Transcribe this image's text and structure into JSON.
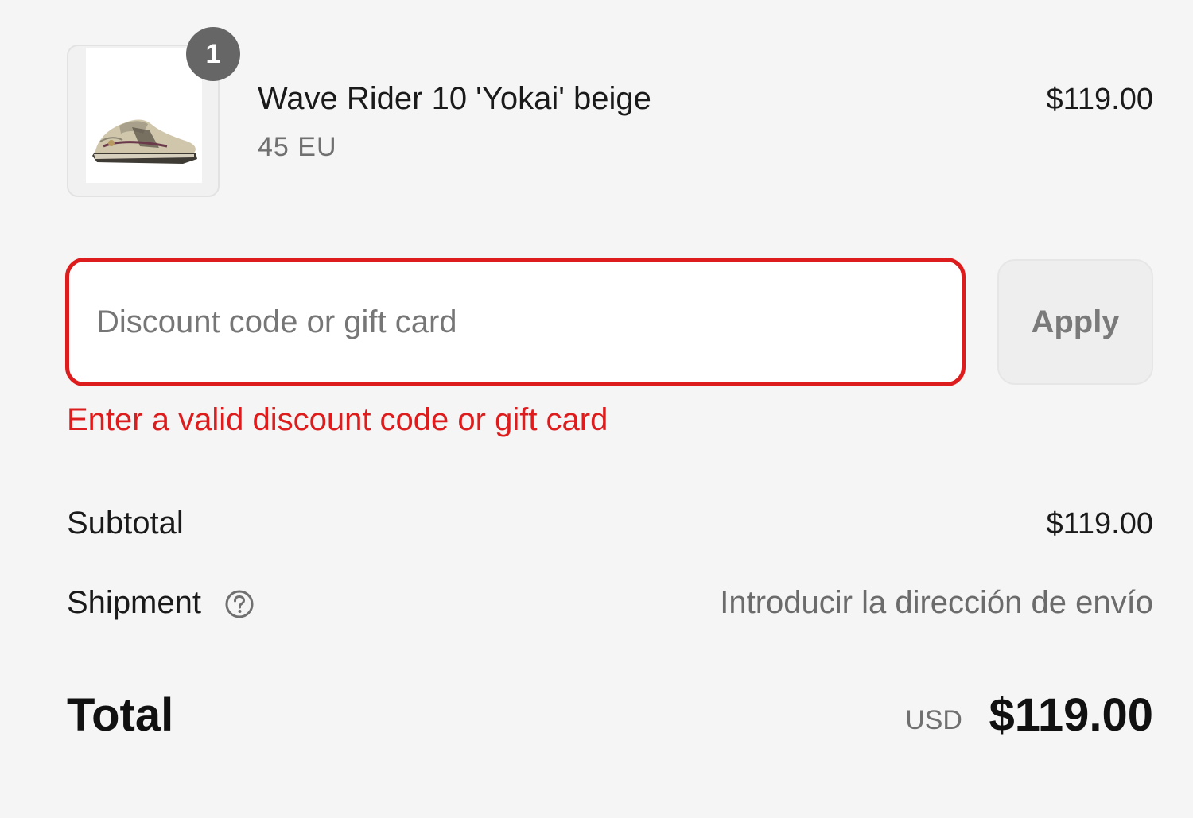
{
  "product": {
    "quantity": "1",
    "name": "Wave Rider 10 'Yokai' beige",
    "variant": "45 EU",
    "price": "$119.00",
    "image_icon": "sneaker-image"
  },
  "discount": {
    "placeholder": "Discount code or gift card",
    "value": "",
    "apply_label": "Apply",
    "error": "Enter a valid discount code or gift card"
  },
  "summary": {
    "subtotal_label": "Subtotal",
    "subtotal_value": "$119.00",
    "shipment_label": "Shipment",
    "shipment_help_icon": "question-circle-icon",
    "shipment_value": "Introducir la dirección de envío",
    "total_label": "Total",
    "total_currency": "USD",
    "total_value": "$119.00"
  },
  "colors": {
    "error": "#dd1d1d",
    "background": "#f5f5f5",
    "badge": "#666666"
  }
}
